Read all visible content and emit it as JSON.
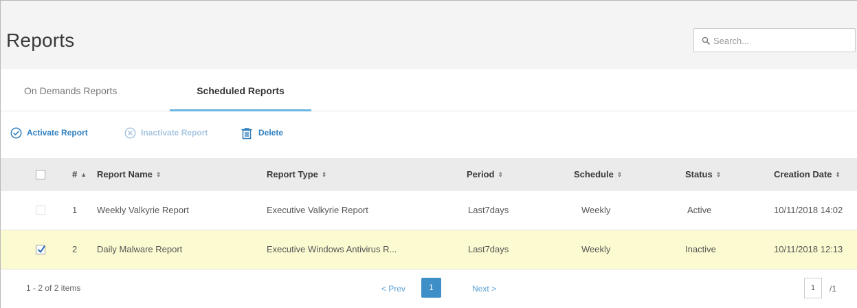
{
  "header": {
    "title": "Reports",
    "search_placeholder": "Search..."
  },
  "tabs": [
    {
      "label": "On Demands Reports",
      "active": false
    },
    {
      "label": "Scheduled Reports",
      "active": true
    }
  ],
  "toolbar": {
    "activate_label": "Activate Report",
    "inactivate_label": "Inactivate Report",
    "delete_label": "Delete"
  },
  "table": {
    "columns": {
      "num": "#",
      "name": "Report Name",
      "type": "Report Type",
      "period": "Period",
      "schedule": "Schedule",
      "status": "Status",
      "date": "Creation Date"
    },
    "rows": [
      {
        "num": "1",
        "name": "Weekly Valkyrie Report",
        "type": "Executive Valkyrie Report",
        "period": "Last7days",
        "schedule": "Weekly",
        "status": "Active",
        "date": "10/11/2018 14:02",
        "checked": false
      },
      {
        "num": "2",
        "name": "Daily Malware Report",
        "type": "Executive Windows Antivirus R...",
        "period": "Last7days",
        "schedule": "Weekly",
        "status": "Inactive",
        "date": "10/11/2018 12:13",
        "checked": true
      }
    ]
  },
  "footer": {
    "items_count": "1 - 2 of 2 items",
    "prev_label": "< Prev",
    "current_page": "1",
    "next_label": "Next >",
    "page_input_value": "1",
    "page_total": "/1"
  },
  "colors": {
    "accent": "#3e8ec7",
    "link": "#2f7fbf",
    "tab_underline": "#6ab5e3",
    "selected_row": "#fbfad0",
    "header_bg": "#f4f4f4",
    "table_header_bg": "#ebebeb"
  },
  "icons": {
    "search": "search-icon",
    "activate": "check-circle-icon",
    "inactivate": "x-circle-icon",
    "delete": "trash-icon",
    "sort": "sort-icon",
    "checkbox_checked": "checkmark-icon"
  }
}
